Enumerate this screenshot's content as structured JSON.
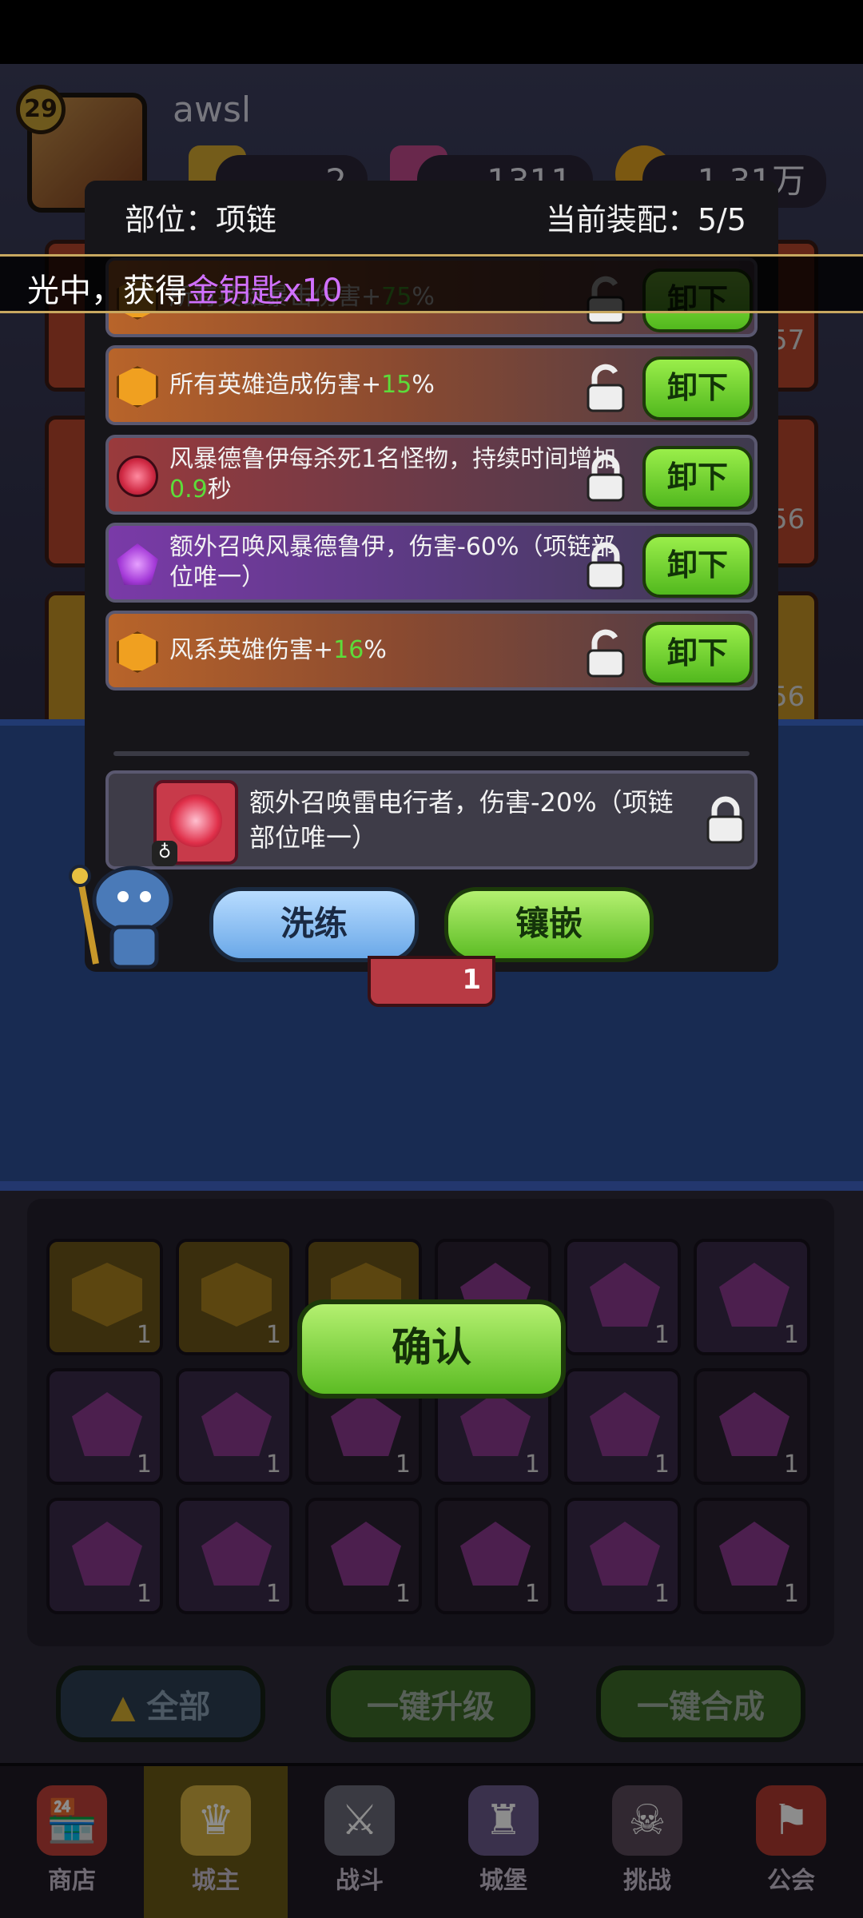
{
  "player": {
    "level": "29",
    "name": "awsl"
  },
  "resources": [
    {
      "name": "gold-gem",
      "value": "2"
    },
    {
      "name": "crystal",
      "value": "1311"
    },
    {
      "name": "coin",
      "value": "1.31万"
    }
  ],
  "side_counts": [
    "57",
    "56",
    "56"
  ],
  "toast": {
    "prefix": "光中，获得",
    "highlight": "金钥匙x10"
  },
  "modal": {
    "slot_label": "部位：项链",
    "equip_count": "当前装配：5/5",
    "affixes": [
      {
        "parts": [
          "所有英雄暴击伤害+",
          "75",
          "%"
        ],
        "color": "orange",
        "icon": "hex-gem-icon",
        "locked": false
      },
      {
        "parts": [
          "所有英雄造成伤害+",
          "15",
          "%"
        ],
        "color": "orange",
        "icon": "hex-gem-icon",
        "locked": false
      },
      {
        "parts": [
          "风暴德鲁伊每杀死1名怪物，持续时间增加",
          "0.9",
          "秒"
        ],
        "color": "red",
        "icon": "red-orb-icon",
        "locked": true
      },
      {
        "parts": [
          "额外召唤风暴德鲁伊，伤害-60%（项链部位唯一）",
          "",
          ""
        ],
        "color": "purple",
        "icon": "purple-gem-icon",
        "locked": true
      },
      {
        "parts": [
          "风系英雄伤害+",
          "16",
          "%"
        ],
        "color": "orange",
        "icon": "hex-gem-icon",
        "locked": false
      }
    ],
    "unload_label": "卸下",
    "new_affix_text": "额外召唤雷电行者，伤害-20%（项链部位唯一）",
    "refine_label": "洗练",
    "inlay_label": "镶嵌",
    "under_qty": "1"
  },
  "confirm_label": "确认",
  "bottom_buttons": {
    "all": "全部",
    "upgrade": "一键升级",
    "merge": "一键合成"
  },
  "nav": [
    {
      "label": "商店",
      "icon": "shop-icon"
    },
    {
      "label": "城主",
      "icon": "crown-icon"
    },
    {
      "label": "战斗",
      "icon": "swords-icon"
    },
    {
      "label": "城堡",
      "icon": "castle-icon"
    },
    {
      "label": "挑战",
      "icon": "demon-icon"
    },
    {
      "label": "公会",
      "icon": "banner-icon"
    }
  ],
  "colors": {
    "accent_green": "#5cdc3a",
    "highlight_purple": "#d070ff"
  }
}
